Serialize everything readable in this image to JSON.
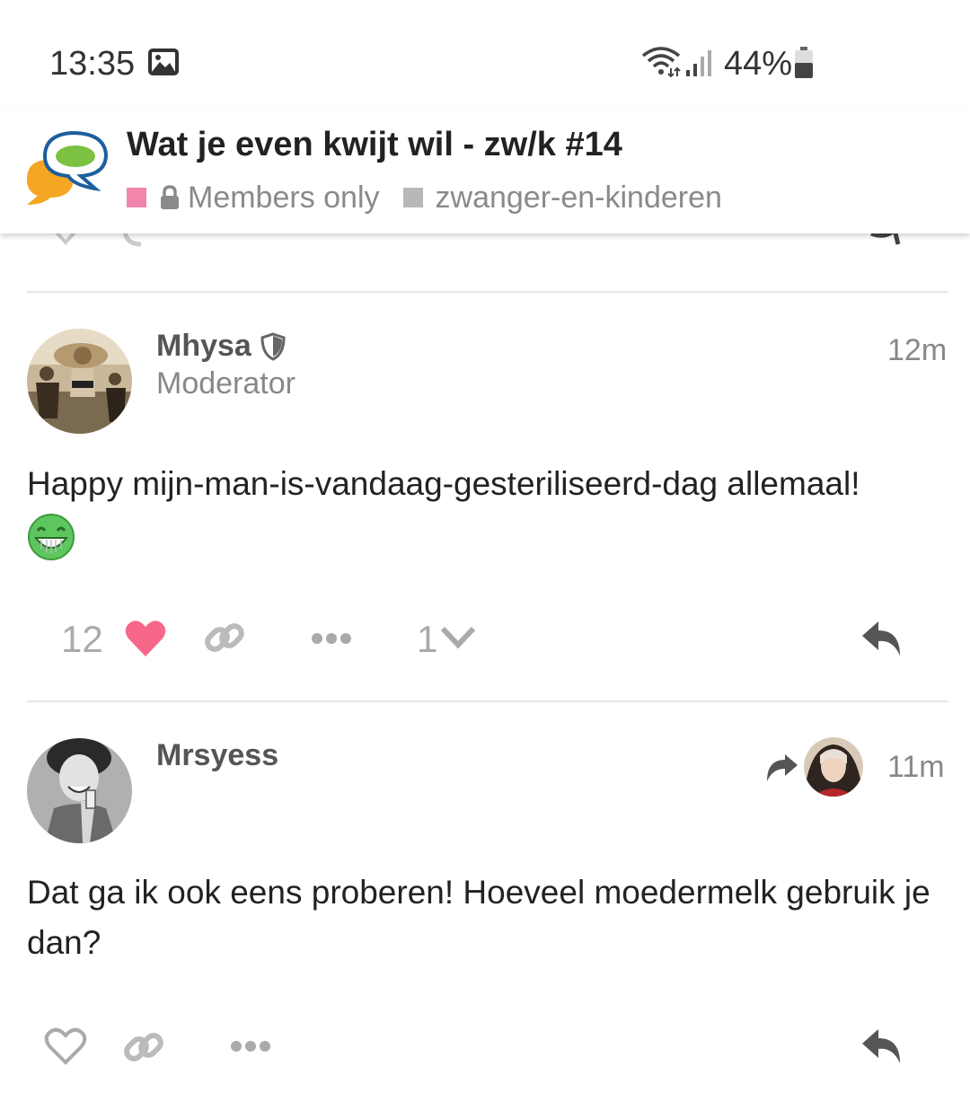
{
  "status_bar": {
    "time": "13:35",
    "battery": "44%"
  },
  "topic": {
    "title": "Wat je even kwijt wil - zw/k #14",
    "category": "Members only",
    "tag": "zwanger-en-kinderen"
  },
  "colors": {
    "like": "#f7678a",
    "category": "#f185ac",
    "tag": "#b8b8b8"
  },
  "posts": [
    {
      "username": "Mhysa",
      "user_title": "Moderator",
      "time": "12m",
      "text": "Happy mijn-man-is-vandaag-gesteriliseerd-dag allemaal!",
      "like_count": "12",
      "reply_count": "1"
    },
    {
      "username": "Mrsyess",
      "time": "11m",
      "text": "Dat ga ik ook eens proberen! Hoeveel moedermelk gebruik je dan?"
    }
  ]
}
